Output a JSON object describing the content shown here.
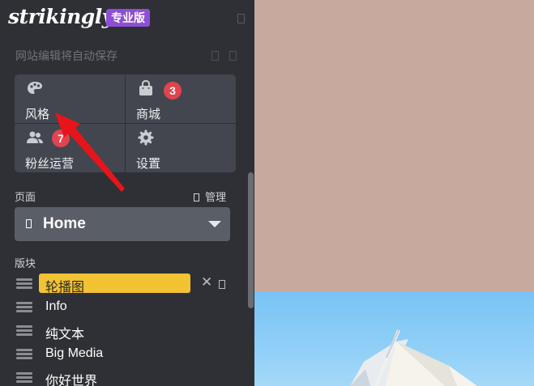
{
  "app": {
    "logo": "strikingly",
    "plan_badge": "专业版",
    "autosave_text": "网站编辑将自动保存"
  },
  "toolbar": [
    {
      "label": "风格",
      "icon": "palette-icon"
    },
    {
      "label": "商城",
      "icon": "shopping-bag-icon",
      "badge": "3"
    },
    {
      "label": "粉丝运营",
      "icon": "users-icon",
      "badge": "7"
    },
    {
      "label": "设置",
      "icon": "gear-icon"
    }
  ],
  "pages": {
    "label": "页面",
    "manage_label": "管理",
    "selected": "Home"
  },
  "blocks": {
    "label": "版块",
    "items": [
      "轮播图",
      "Info",
      "纯文本",
      "Big Media",
      "你好世界"
    ],
    "selected_index": 0
  },
  "colors": {
    "sidebar_bg": "#2e3035",
    "tile_bg": "#43464e",
    "badge_red": "#e0444e",
    "plan_purple": "#8c4fd6",
    "selected_yellow": "#f1c232",
    "annotation_arrow": "#e8141c"
  }
}
